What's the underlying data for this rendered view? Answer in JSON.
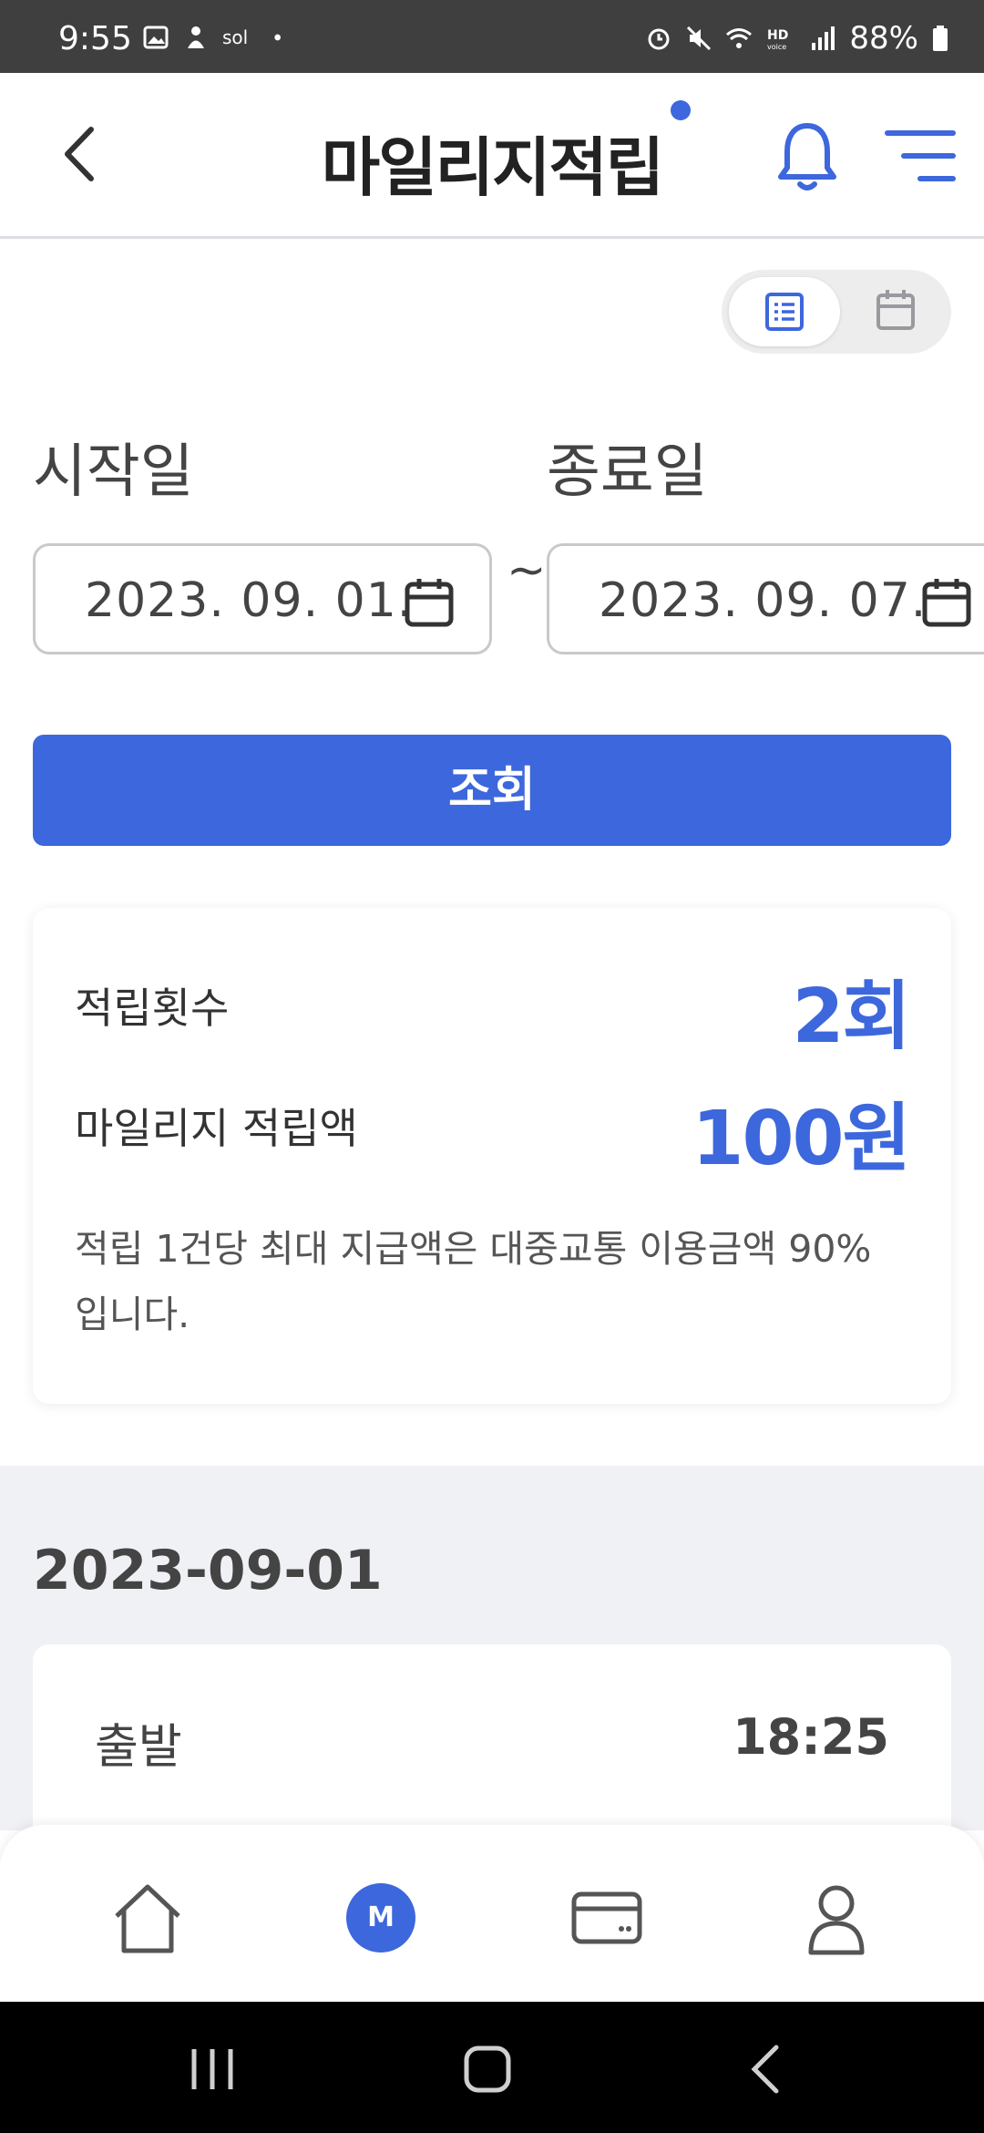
{
  "status_bar": {
    "time": "9:55",
    "battery": "88%",
    "icons": [
      "gallery-icon",
      "app-icon",
      "sol-icon",
      "dot-icon",
      "alarm-icon",
      "mute-icon",
      "wifi-icon",
      "hd-voice-icon",
      "signal-icon",
      "battery-icon"
    ]
  },
  "header": {
    "title": "마일리지적립",
    "back_icon": "chevron-left-icon",
    "bell_icon": "bell-icon",
    "menu_icon": "menu-icon"
  },
  "view_toggle": {
    "selected": "list",
    "options": [
      "list-icon",
      "calendar-icon"
    ]
  },
  "date_range": {
    "start_label": "시작일",
    "end_label": "종료일",
    "start_value": "2023. 09. 01.",
    "end_value": "2023. 09. 07.",
    "separator": "~"
  },
  "search_button": "조회",
  "summary": {
    "count_label": "적립횟수",
    "count_value": "2회",
    "amount_label": "마일리지 적립액",
    "amount_value": "100원",
    "note": "적립 1건당 최대 지급액은 대중교통 이용금액 90% 입니다."
  },
  "history": {
    "date": "2023-09-01",
    "trip_label": "출발",
    "trip_time": "18:25"
  },
  "bottom_nav": {
    "items": [
      "home-icon",
      "mileage-icon",
      "card-icon",
      "user-icon"
    ],
    "m_label": "M",
    "active": "mileage"
  },
  "colors": {
    "accent": "#3d67dc",
    "status_bar": "#3f3f3f",
    "section_bg": "#f0f1f5"
  }
}
